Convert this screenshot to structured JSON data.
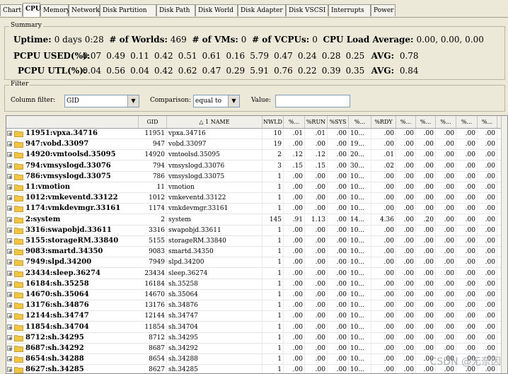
{
  "tabs": [
    "Chart",
    "CPU",
    "Memory",
    "Network",
    "Disk Partition",
    "Disk Path",
    "Disk World",
    "Disk Adapter",
    "Disk VSCSI",
    "Interrupts",
    "Power"
  ],
  "active_tab": "CPU",
  "summary": {
    "title": "Summary",
    "uptime_label": "Uptime:",
    "uptime_value": "0 days 0:28",
    "worlds_label": "# of Worlds:",
    "worlds_value": "469",
    "vms_label": "# of VMs:",
    "vms_value": "0",
    "vcpus_label": "# of VCPUs:",
    "vcpus_value": "0",
    "load_label": "CPU Load Average:",
    "load_value": "0.00, 0.00, 0.00",
    "used_label": "PCPU USED(%):",
    "used_values": [
      "0.07",
      "0.49",
      "0.11",
      "0.42",
      "0.51",
      "0.61",
      "0.16",
      "5.79",
      "0.47",
      "0.24",
      "0.28",
      "0.25"
    ],
    "used_avg_label": "AVG:",
    "used_avg_value": "0.78",
    "util_label": "PCPU UTL(%):",
    "util_values": [
      "0.04",
      "0.56",
      "0.04",
      "0.42",
      "0.62",
      "0.47",
      "0.29",
      "5.91",
      "0.76",
      "0.22",
      "0.39",
      "0.35"
    ],
    "util_avg_label": "AVG:",
    "util_avg_value": "0.84"
  },
  "filter": {
    "title": "Filter",
    "column_label": "Column filter:",
    "column_value": "GID",
    "comparison_label": "Comparison:",
    "comparison_value": "equal to",
    "value_label": "Value:",
    "value_value": ""
  },
  "table": {
    "headers": [
      "GID",
      "△ 1 NAME",
      "NWLD",
      "%...",
      "%RUN",
      "%SYS",
      "%...",
      "%RDY",
      "%...",
      "%...",
      "%...",
      "%...",
      "%..."
    ],
    "rows": [
      {
        "tree": "11951:vpxa.34716",
        "gid": "11951",
        "name": "vpxa.34716",
        "nwld": "10",
        "c1": ".01",
        "run": ".01",
        "sys": ".00",
        "c4": "10...",
        "rdy": ".00",
        "c6": ".00",
        "c7": ".00",
        "c8": ".00",
        "c9": ".00"
      },
      {
        "tree": "947:vobd.33097",
        "gid": "947",
        "name": "vobd.33097",
        "nwld": "19",
        "c1": ".00",
        "run": ".00",
        "sys": ".00",
        "c4": "19...",
        "rdy": ".00",
        "c6": ".00",
        "c7": ".00",
        "c8": ".00",
        "c9": ".00"
      },
      {
        "tree": "14920:vmtoolsd.35095",
        "gid": "14920",
        "name": "vmtoolsd.35095",
        "nwld": "2",
        "c1": ".12",
        "run": ".12",
        "sys": ".00",
        "c4": "20...",
        "rdy": ".01",
        "c6": ".00",
        "c7": ".00",
        "c8": ".00",
        "c9": ".00"
      },
      {
        "tree": "794:vmsyslogd.33076",
        "gid": "794",
        "name": "vmsyslogd.33076",
        "nwld": "3",
        "c1": ".15",
        "run": ".15",
        "sys": ".00",
        "c4": "30...",
        "rdy": ".02",
        "c6": ".00",
        "c7": ".00",
        "c8": ".00",
        "c9": ".00"
      },
      {
        "tree": "786:vmsyslogd.33075",
        "gid": "786",
        "name": "vmsyslogd.33075",
        "nwld": "1",
        "c1": ".00",
        "run": ".00",
        "sys": ".00",
        "c4": "10...",
        "rdy": ".00",
        "c6": ".00",
        "c7": ".00",
        "c8": ".00",
        "c9": ".00"
      },
      {
        "tree": "11:vmotion",
        "gid": "11",
        "name": "vmotion",
        "nwld": "1",
        "c1": ".00",
        "run": ".00",
        "sys": ".00",
        "c4": "10...",
        "rdy": ".00",
        "c6": ".00",
        "c7": ".00",
        "c8": ".00",
        "c9": ".00"
      },
      {
        "tree": "1012:vmkeventd.33122",
        "gid": "1012",
        "name": "vmkeventd.33122",
        "nwld": "1",
        "c1": ".00",
        "run": ".00",
        "sys": ".00",
        "c4": "10...",
        "rdy": ".00",
        "c6": ".00",
        "c7": ".00",
        "c8": ".00",
        "c9": ".00"
      },
      {
        "tree": "1174:vmkdevmgr.33161",
        "gid": "1174",
        "name": "vmkdevmgr.33161",
        "nwld": "1",
        "c1": ".00",
        "run": ".00",
        "sys": ".00",
        "c4": "10...",
        "rdy": ".00",
        "c6": ".00",
        "c7": ".00",
        "c8": ".00",
        "c9": ".00"
      },
      {
        "tree": "2:system",
        "gid": "2",
        "name": "system",
        "nwld": "145",
        "c1": ".91",
        "run": "1.13",
        "sys": ".00",
        "c4": "14...",
        "rdy": "4.36",
        "c6": ".00",
        "c7": ".20",
        "c8": ".00",
        "c9": ".00"
      },
      {
        "tree": "3316:swapobjd.33611",
        "gid": "3316",
        "name": "swapobjd.33611",
        "nwld": "1",
        "c1": ".00",
        "run": ".00",
        "sys": ".00",
        "c4": "10...",
        "rdy": ".00",
        "c6": ".00",
        "c7": ".00",
        "c8": ".00",
        "c9": ".00"
      },
      {
        "tree": "5155:storageRM.33840",
        "gid": "5155",
        "name": "storageRM.33840",
        "nwld": "1",
        "c1": ".00",
        "run": ".00",
        "sys": ".00",
        "c4": "10...",
        "rdy": ".00",
        "c6": ".00",
        "c7": ".00",
        "c8": ".00",
        "c9": ".00"
      },
      {
        "tree": "9083:smartd.34350",
        "gid": "9083",
        "name": "smartd.34350",
        "nwld": "1",
        "c1": ".00",
        "run": ".00",
        "sys": ".00",
        "c4": "10...",
        "rdy": ".00",
        "c6": ".00",
        "c7": ".00",
        "c8": ".00",
        "c9": ".00"
      },
      {
        "tree": "7949:slpd.34200",
        "gid": "7949",
        "name": "slpd.34200",
        "nwld": "1",
        "c1": ".00",
        "run": ".00",
        "sys": ".00",
        "c4": "10...",
        "rdy": ".00",
        "c6": ".00",
        "c7": ".00",
        "c8": ".00",
        "c9": ".00"
      },
      {
        "tree": "23434:sleep.36274",
        "gid": "23434",
        "name": "sleep.36274",
        "nwld": "1",
        "c1": ".00",
        "run": ".00",
        "sys": ".00",
        "c4": "10...",
        "rdy": ".00",
        "c6": ".00",
        "c7": ".00",
        "c8": ".00",
        "c9": ".00"
      },
      {
        "tree": "16184:sh.35258",
        "gid": "16184",
        "name": "sh.35258",
        "nwld": "1",
        "c1": ".00",
        "run": ".00",
        "sys": ".00",
        "c4": "10...",
        "rdy": ".00",
        "c6": ".00",
        "c7": ".00",
        "c8": ".00",
        "c9": ".00"
      },
      {
        "tree": "14670:sh.35064",
        "gid": "14670",
        "name": "sh.35064",
        "nwld": "1",
        "c1": ".00",
        "run": ".00",
        "sys": ".00",
        "c4": "10...",
        "rdy": ".00",
        "c6": ".00",
        "c7": ".00",
        "c8": ".00",
        "c9": ".00"
      },
      {
        "tree": "13176:sh.34876",
        "gid": "13176",
        "name": "sh.34876",
        "nwld": "1",
        "c1": ".00",
        "run": ".00",
        "sys": ".00",
        "c4": "10...",
        "rdy": ".00",
        "c6": ".00",
        "c7": ".00",
        "c8": ".00",
        "c9": ".00"
      },
      {
        "tree": "12144:sh.34747",
        "gid": "12144",
        "name": "sh.34747",
        "nwld": "1",
        "c1": ".00",
        "run": ".00",
        "sys": ".00",
        "c4": "10...",
        "rdy": ".00",
        "c6": ".00",
        "c7": ".00",
        "c8": ".00",
        "c9": ".00"
      },
      {
        "tree": "11854:sh.34704",
        "gid": "11854",
        "name": "sh.34704",
        "nwld": "1",
        "c1": ".00",
        "run": ".00",
        "sys": ".00",
        "c4": "10...",
        "rdy": ".00",
        "c6": ".00",
        "c7": ".00",
        "c8": ".00",
        "c9": ".00"
      },
      {
        "tree": "8712:sh.34295",
        "gid": "8712",
        "name": "sh.34295",
        "nwld": "1",
        "c1": ".00",
        "run": ".00",
        "sys": ".00",
        "c4": "10...",
        "rdy": ".00",
        "c6": ".00",
        "c7": ".00",
        "c8": ".00",
        "c9": ".00"
      },
      {
        "tree": "8687:sh.34292",
        "gid": "8687",
        "name": "sh.34292",
        "nwld": "1",
        "c1": ".00",
        "run": ".00",
        "sys": ".00",
        "c4": "10...",
        "rdy": ".00",
        "c6": ".00",
        "c7": ".00",
        "c8": ".00",
        "c9": ".00"
      },
      {
        "tree": "8654:sh.34288",
        "gid": "8654",
        "name": "sh.34288",
        "nwld": "1",
        "c1": ".00",
        "run": ".00",
        "sys": ".00",
        "c4": "10...",
        "rdy": ".00",
        "c6": ".00",
        "c7": ".00",
        "c8": ".00",
        "c9": ".00"
      },
      {
        "tree": "8627:sh.34285",
        "gid": "8627",
        "name": "sh.34285",
        "nwld": "1",
        "c1": ".00",
        "run": ".00",
        "sys": ".00",
        "c4": "10...",
        "rdy": ".00",
        "c6": ".00",
        "c7": ".00",
        "c8": ".00",
        "c9": ".00"
      }
    ]
  },
  "watermark": "CSDN @无奈因"
}
